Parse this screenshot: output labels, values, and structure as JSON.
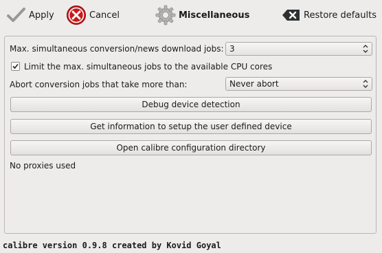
{
  "toolbar": {
    "apply_label": "Apply",
    "cancel_label": "Cancel",
    "section_label": "Miscellaneous",
    "restore_label": "Restore defaults"
  },
  "settings": {
    "max_jobs_label": "Max. simultaneous conversion/news download jobs:",
    "max_jobs_value": "3",
    "limit_cpu_label": "Limit the max. simultaneous jobs to the available CPU cores",
    "limit_cpu_checked": true,
    "abort_label": "Abort conversion jobs that take more than:",
    "abort_value": "Never abort",
    "debug_button": "Debug device detection",
    "info_button": "Get information to setup the user defined device",
    "config_button": "Open calibre configuration directory",
    "proxies_text": "No proxies used"
  },
  "footer": {
    "version_text": "calibre version 0.9.8 created by Kovid Goyal"
  },
  "colors": {
    "background": "#edeceb",
    "cancel_red": "#c8191c",
    "restore_dark": "#2e3133"
  },
  "icons": {
    "apply": "checkmark-icon",
    "cancel": "cancel-icon",
    "section": "gear-icon",
    "restore": "backspace-icon"
  }
}
